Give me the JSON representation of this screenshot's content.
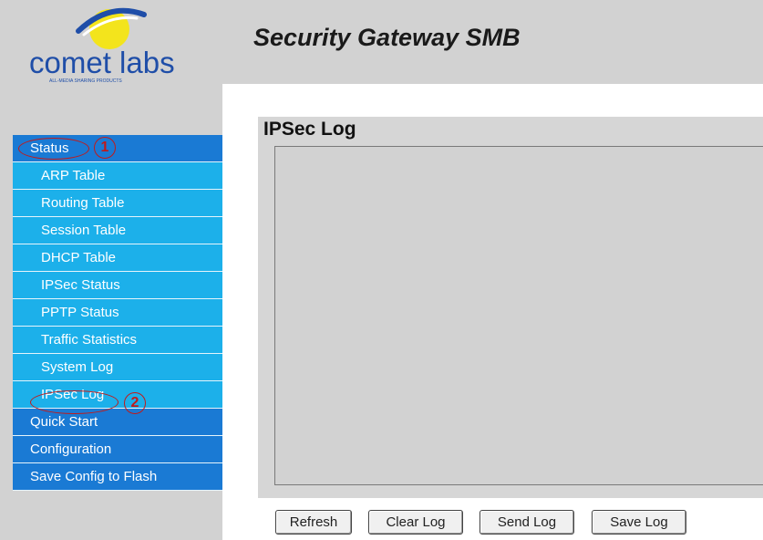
{
  "header": {
    "logo_text": "comet labs",
    "logo_tagline": "ALL-MEDIA SHARING PRODUCTS",
    "title": "Security Gateway SMB"
  },
  "sidebar": {
    "items": [
      {
        "label": "Status",
        "level": "top",
        "annotation": "1"
      },
      {
        "label": "ARP Table",
        "level": "sub"
      },
      {
        "label": "Routing Table",
        "level": "sub"
      },
      {
        "label": "Session Table",
        "level": "sub"
      },
      {
        "label": "DHCP Table",
        "level": "sub"
      },
      {
        "label": "IPSec Status",
        "level": "sub"
      },
      {
        "label": "PPTP Status",
        "level": "sub"
      },
      {
        "label": "Traffic Statistics",
        "level": "sub"
      },
      {
        "label": "System Log",
        "level": "sub"
      },
      {
        "label": "IPSec Log",
        "level": "sub",
        "annotation": "2"
      },
      {
        "label": "Quick Start",
        "level": "top"
      },
      {
        "label": "Configuration",
        "level": "top"
      },
      {
        "label": "Save Config to Flash",
        "level": "top"
      }
    ]
  },
  "main": {
    "panel_title": "IPSec Log",
    "log_content": "",
    "buttons": {
      "refresh": "Refresh",
      "clear_log": "Clear Log",
      "send_log": "Send Log",
      "save_log": "Save Log"
    }
  },
  "colors": {
    "menu_top": "#1a7ad4",
    "menu_sub": "#1cb0ea",
    "annotation": "#c11a1a",
    "logo_text": "#1f4ea8",
    "logo_sun": "#f3e41c"
  }
}
